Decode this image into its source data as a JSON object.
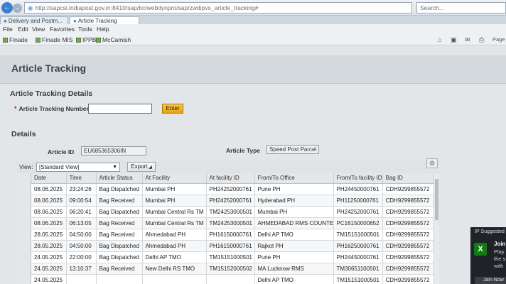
{
  "browser": {
    "url": "http://sapcsi.indiapost.gov.in:8410/sap/bc/webdynpro/sap/zwdipvs_article_tracking#",
    "search_placeholder": "Search...",
    "tabs": [
      {
        "label": "Delivery and Postm..."
      },
      {
        "label": "Article Tracking"
      }
    ],
    "menu": [
      "File",
      "Edit",
      "View",
      "Favorites",
      "Tools",
      "Help"
    ],
    "favorites": [
      "Finade",
      "Finade MIS",
      "IPPB",
      "McCamish"
    ],
    "page_menu": "Page"
  },
  "page": {
    "title": "Article Tracking",
    "details_section_title": "Article Tracking Details",
    "tracking_label": "Article Tracking Number",
    "tracking_value": "",
    "enter_label": "Enter"
  },
  "details": {
    "section_title": "Details",
    "article_id_label": "Article ID",
    "article_id_value": "EU685365306IN",
    "article_type_label": "Article Type",
    "article_type_value": "Speed Post Parcel I"
  },
  "table": {
    "view_label": "View:",
    "view_value": "[Standard View]",
    "export_label": "Export",
    "columns": [
      "Date",
      "Time",
      "Article Status",
      "At Facility",
      "At facility ID",
      "From/To Office",
      "From/To facility ID",
      "Bag ID"
    ],
    "rows": [
      [
        "08.06.2025",
        "23:24:26",
        "Bag Dispatched",
        "Mumbai PH",
        "PH24252000761",
        "Pune PH",
        "PH24450000761",
        "CDH9299855572"
      ],
      [
        "08.06.2025",
        "09:00:54",
        "Bag Received",
        "Mumbai PH",
        "PH24252000761",
        "Hyderabad PH",
        "PH11250000761",
        "CDH9299855572"
      ],
      [
        "08.06.2025",
        "06:20:41",
        "Bag Dispatched",
        "Mumbai Central Rs TM",
        "TM24253000501",
        "Mumbai PH",
        "PH24252000761",
        "CDH9299855572"
      ],
      [
        "08.06.2025",
        "06:13:05",
        "Bag Received",
        "Mumbai Central Rs TM",
        "TM24253000501",
        "AHMEDABAD RMS COUNTE",
        "PC16150000652",
        "CDH9299855572"
      ],
      [
        "28.05.2025",
        "04:50:00",
        "Bag Received",
        "Ahmedabad PH",
        "PH16150000761",
        "Delhi AP TMO",
        "TM15151000501",
        "CDH9299855572"
      ],
      [
        "28.05.2025",
        "04:50:00",
        "Bag Dispatched",
        "Ahmedabad PH",
        "PH16150000761",
        "Rajkot PH",
        "PH16250000761",
        "CDH9299855572"
      ],
      [
        "24.05.2025",
        "22:00:00",
        "Bag Dispatched",
        "Delhi AP TMO",
        "TM15151000501",
        "Pune PH",
        "PH24450000761",
        "CDH9299855572"
      ],
      [
        "24.05.2025",
        "13:10:37",
        "Bag Received",
        "New Delhi RS TMO",
        "TM15152000502",
        "MA Lucknow RMS",
        "TM30651100501",
        "CDH9299855572"
      ],
      [
        "24.05.2025",
        "",
        "",
        "",
        "",
        "Delhi AP TMO",
        "TM15151000501",
        "CDH9299855572"
      ]
    ]
  },
  "notification": {
    "header": "IP Suggested",
    "title": "Join",
    "lines": [
      "Play",
      "the s",
      "with"
    ],
    "button": "Join Now"
  }
}
